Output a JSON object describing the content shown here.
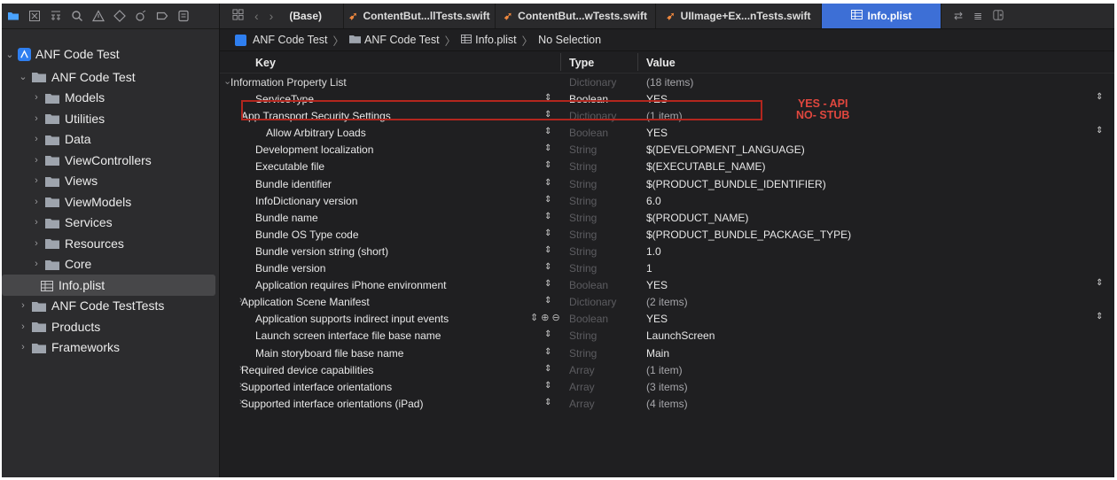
{
  "toolbar": {
    "icons": [
      "folder-icon",
      "source-control-icon",
      "symbol-icon",
      "search-icon",
      "warning-icon",
      "test-icon",
      "debug-icon",
      "breakpoint-icon",
      "report-icon"
    ]
  },
  "sidebar": {
    "root": "ANF Code Test",
    "group": "ANF Code Test",
    "items": [
      {
        "label": "Models"
      },
      {
        "label": "Utilities"
      },
      {
        "label": "Data"
      },
      {
        "label": "ViewControllers"
      },
      {
        "label": "Views"
      },
      {
        "label": "ViewModels"
      },
      {
        "label": "Services"
      },
      {
        "label": "Resources"
      },
      {
        "label": "Core"
      }
    ],
    "selected_file": "Info.plist",
    "after": [
      {
        "label": "ANF Code TestTests"
      },
      {
        "label": "Products"
      },
      {
        "label": "Frameworks"
      }
    ]
  },
  "tabs": {
    "base": "(Base)",
    "items": [
      {
        "label": "ContentBut...llTests.swift"
      },
      {
        "label": "ContentBut...wTests.swift"
      },
      {
        "label": "UIImage+Ex...nTests.swift"
      },
      {
        "label": "Info.plist"
      }
    ]
  },
  "jumpbar": {
    "project": "ANF Code Test",
    "group": "ANF Code Test",
    "file": "Info.plist",
    "selection": "No Selection"
  },
  "plist": {
    "headers": {
      "key": "Key",
      "type": "Type",
      "value": "Value"
    },
    "rows": [
      {
        "key": "Information Property List",
        "type": "Dictionary",
        "value": "(18 items)",
        "disc": "v",
        "indent": 0,
        "dimType": true,
        "dimVal": true
      },
      {
        "key": "ServiceType",
        "type": "Boolean",
        "value": "YES",
        "indent": 2,
        "step": true,
        "rstep": true
      },
      {
        "key": "App Transport Security Settings",
        "type": "Dictionary",
        "value": "(1 item)",
        "disc": "v",
        "indent": 1,
        "step": true,
        "dimType": true,
        "dimVal": true
      },
      {
        "key": "Allow Arbitrary Loads",
        "type": "Boolean",
        "value": "YES",
        "indent": 3,
        "step": true,
        "rstep": true,
        "dimType": true
      },
      {
        "key": "Development localization",
        "type": "String",
        "value": "$(DEVELOPMENT_LANGUAGE)",
        "indent": 2,
        "step": true,
        "dimType": true
      },
      {
        "key": "Executable file",
        "type": "String",
        "value": "$(EXECUTABLE_NAME)",
        "indent": 2,
        "step": true,
        "dimType": true
      },
      {
        "key": "Bundle identifier",
        "type": "String",
        "value": "$(PRODUCT_BUNDLE_IDENTIFIER)",
        "indent": 2,
        "step": true,
        "dimType": true
      },
      {
        "key": "InfoDictionary version",
        "type": "String",
        "value": "6.0",
        "indent": 2,
        "step": true,
        "dimType": true
      },
      {
        "key": "Bundle name",
        "type": "String",
        "value": "$(PRODUCT_NAME)",
        "indent": 2,
        "step": true,
        "dimType": true
      },
      {
        "key": "Bundle OS Type code",
        "type": "String",
        "value": "$(PRODUCT_BUNDLE_PACKAGE_TYPE)",
        "indent": 2,
        "step": true,
        "dimType": true
      },
      {
        "key": "Bundle version string (short)",
        "type": "String",
        "value": "1.0",
        "indent": 2,
        "step": true,
        "dimType": true
      },
      {
        "key": "Bundle version",
        "type": "String",
        "value": "1",
        "indent": 2,
        "step": true,
        "dimType": true
      },
      {
        "key": "Application requires iPhone environment",
        "type": "Boolean",
        "value": "YES",
        "indent": 2,
        "step": true,
        "rstep": true,
        "dimType": true
      },
      {
        "key": "Application Scene Manifest",
        "type": "Dictionary",
        "value": "(2 items)",
        "disc": ">",
        "indent": 1,
        "step": true,
        "dimType": true,
        "dimVal": true
      },
      {
        "key": "Application supports indirect input events",
        "type": "Boolean",
        "value": "YES",
        "indent": 2,
        "addrm": true,
        "rstep": true,
        "dimType": true
      },
      {
        "key": "Launch screen interface file base name",
        "type": "String",
        "value": "LaunchScreen",
        "indent": 2,
        "step": true,
        "dimType": true
      },
      {
        "key": "Main storyboard file base name",
        "type": "String",
        "value": "Main",
        "indent": 2,
        "step": true,
        "dimType": true
      },
      {
        "key": "Required device capabilities",
        "type": "Array",
        "value": "(1 item)",
        "disc": ">",
        "indent": 1,
        "step": true,
        "dimType": true,
        "dimVal": true
      },
      {
        "key": "Supported interface orientations",
        "type": "Array",
        "value": "(3 items)",
        "disc": ">",
        "indent": 1,
        "step": true,
        "dimType": true,
        "dimVal": true
      },
      {
        "key": "Supported interface orientations (iPad)",
        "type": "Array",
        "value": "(4 items)",
        "disc": ">",
        "indent": 1,
        "step": true,
        "dimType": true,
        "dimVal": true
      }
    ]
  },
  "annotation": {
    "line1": "YES - API",
    "line2": "NO- STUB",
    "color": "#e0473e"
  },
  "colors": {
    "accent": "#3d6fd6",
    "swift": "#f0883e",
    "highlight": "#b3261e"
  }
}
